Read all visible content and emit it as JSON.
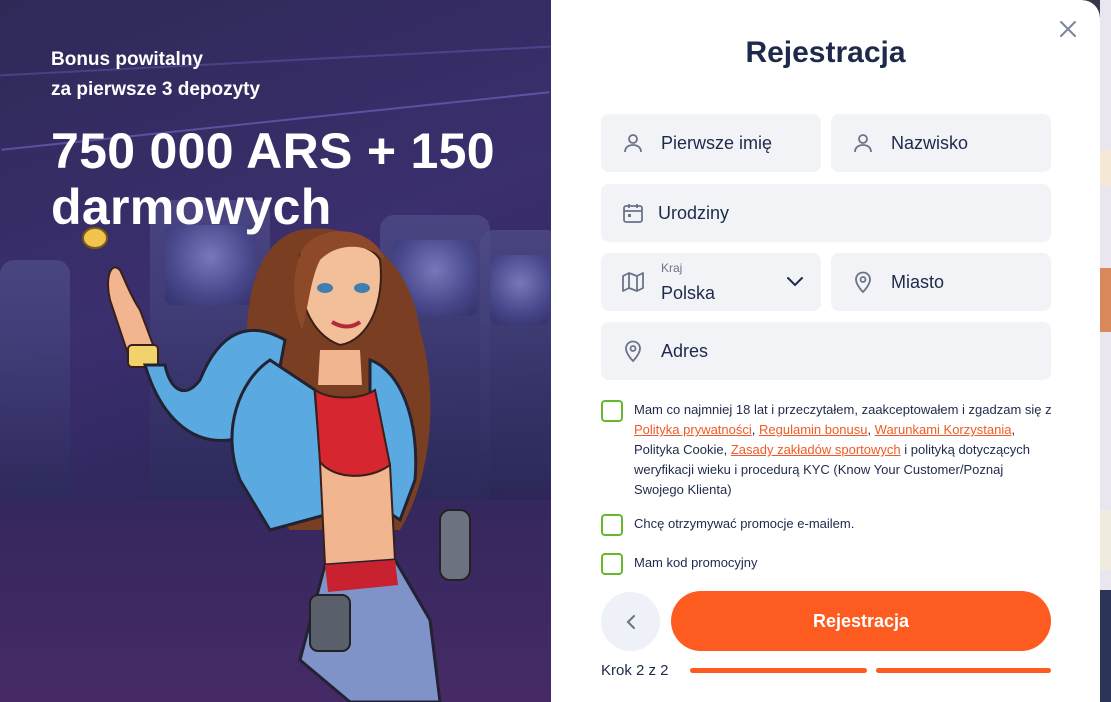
{
  "promo": {
    "subtitle_line1": "Bonus powitalny",
    "subtitle_line2": "za pierwsze 3 depozyty",
    "headline_line1": "750 000 ARS + 150",
    "headline_line2": "darmowych"
  },
  "form": {
    "title": "Rejestracja",
    "first_name_placeholder": "Pierwsze imię",
    "last_name_placeholder": "Nazwisko",
    "birthday_placeholder": "Urodziny",
    "country_label": "Kraj",
    "country_value": "Polska",
    "city_placeholder": "Miasto",
    "address_placeholder": "Adres"
  },
  "consent": {
    "text_1": "Mam co najmniej 18 lat i przeczytałem, zaakceptowałem i zgadzam się z ",
    "link_privacy": "Polityka prywatności",
    "sep_1": ", ",
    "link_bonus": "Regulamin bonusu",
    "sep_2": ", ",
    "link_terms": "Warunkami Korzystania",
    "text_2": ", Polityka Cookie, ",
    "link_sports": "Zasady zakładów sportowych",
    "text_3": " i polityką dotyczących weryfikacji wieku i procedurą KYC (Know Your Customer/Poznaj Swojego Klienta)"
  },
  "email_promo_label": "Chcę otrzymywać promocje e-mailem.",
  "promo_code_label": "Mam kod promocyjny",
  "submit_label": "Rejestracja",
  "step_label": "Krok 2 z 2",
  "colors": {
    "accent": "#fd5b1f",
    "checkbox_border": "#66b82e",
    "field_bg": "#f1f3f7",
    "text": "#1e2a4a"
  }
}
